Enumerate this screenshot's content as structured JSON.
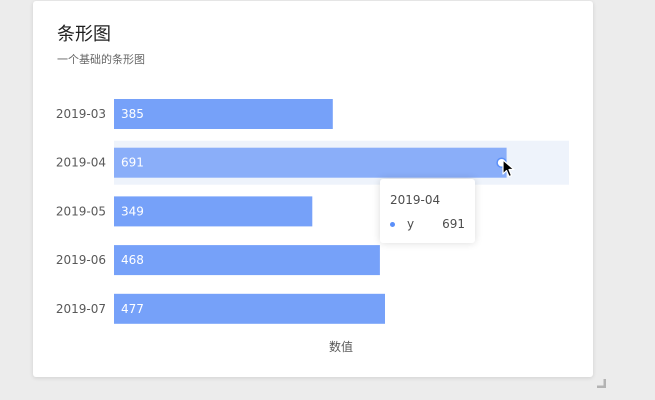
{
  "card": {
    "title": "条形图",
    "subtitle": "一个基础的条形图"
  },
  "chart_data": {
    "type": "bar",
    "orientation": "horizontal",
    "categories": [
      "2019-03",
      "2019-04",
      "2019-05",
      "2019-06",
      "2019-07"
    ],
    "values": [
      385,
      691,
      349,
      468,
      477
    ],
    "xlabel": "数值",
    "ylabel": "",
    "grid": false,
    "colors": {
      "bar": "#76a1f9",
      "bar_active": "#8aaef9",
      "highlight_band": "#eef3fb",
      "label_text": "#ffffff",
      "axis_text": "#595959"
    }
  },
  "tooltip": {
    "title": "2019-04",
    "name": "y",
    "value": "691",
    "marker_color": "#5b8ff9"
  },
  "icons": {
    "cursor": "arrow-cursor-icon",
    "resize": "resize-corner-icon"
  }
}
